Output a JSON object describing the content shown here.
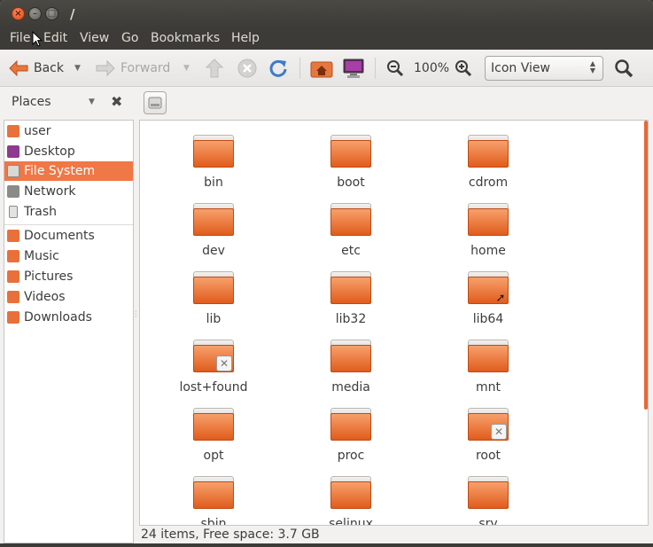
{
  "window": {
    "title": "/",
    "buttons": {
      "close": "×",
      "minimize": "–",
      "maximize": "□"
    }
  },
  "menu": [
    "File",
    "Edit",
    "View",
    "Go",
    "Bookmarks",
    "Help"
  ],
  "toolbar": {
    "back_label": "Back",
    "forward_label": "Forward",
    "zoom_level": "100%",
    "view_mode": "Icon View"
  },
  "places": {
    "title": "Places",
    "items": [
      {
        "label": "user",
        "icon": "home-folder-icon",
        "color": "#e9703a"
      },
      {
        "label": "Desktop",
        "icon": "desktop-icon",
        "color": "#8e3a8e"
      },
      {
        "label": "File System",
        "icon": "drive-icon",
        "color": "#b9b8b5",
        "selected": true
      },
      {
        "label": "Network",
        "icon": "network-icon",
        "color": "#8a8a88"
      },
      {
        "label": "Trash",
        "icon": "trash-icon",
        "color": "#cfcfcd"
      },
      {
        "label": "Documents",
        "icon": "documents-folder-icon",
        "color": "#e9703a"
      },
      {
        "label": "Music",
        "icon": "music-folder-icon",
        "color": "#e9703a"
      },
      {
        "label": "Pictures",
        "icon": "pictures-folder-icon",
        "color": "#e9703a"
      },
      {
        "label": "Videos",
        "icon": "videos-folder-icon",
        "color": "#e9703a"
      },
      {
        "label": "Downloads",
        "icon": "downloads-folder-icon",
        "color": "#e9703a"
      }
    ]
  },
  "files": [
    {
      "name": "bin",
      "badge": ""
    },
    {
      "name": "boot",
      "badge": ""
    },
    {
      "name": "cdrom",
      "badge": ""
    },
    {
      "name": "dev",
      "badge": ""
    },
    {
      "name": "etc",
      "badge": ""
    },
    {
      "name": "home",
      "badge": ""
    },
    {
      "name": "lib",
      "badge": ""
    },
    {
      "name": "lib32",
      "badge": ""
    },
    {
      "name": "lib64",
      "badge": "link"
    },
    {
      "name": "lost+found",
      "badge": "locked"
    },
    {
      "name": "media",
      "badge": ""
    },
    {
      "name": "mnt",
      "badge": ""
    },
    {
      "name": "opt",
      "badge": ""
    },
    {
      "name": "proc",
      "badge": ""
    },
    {
      "name": "root",
      "badge": "locked"
    },
    {
      "name": "sbin",
      "badge": ""
    },
    {
      "name": "selinux",
      "badge": ""
    },
    {
      "name": "srv",
      "badge": ""
    }
  ],
  "status": {
    "text": "24 items, Free space: 3.7 GB"
  },
  "colors": {
    "accent": "#f07746",
    "folder": "#e9703a",
    "titlebar": "#3c3b37"
  }
}
